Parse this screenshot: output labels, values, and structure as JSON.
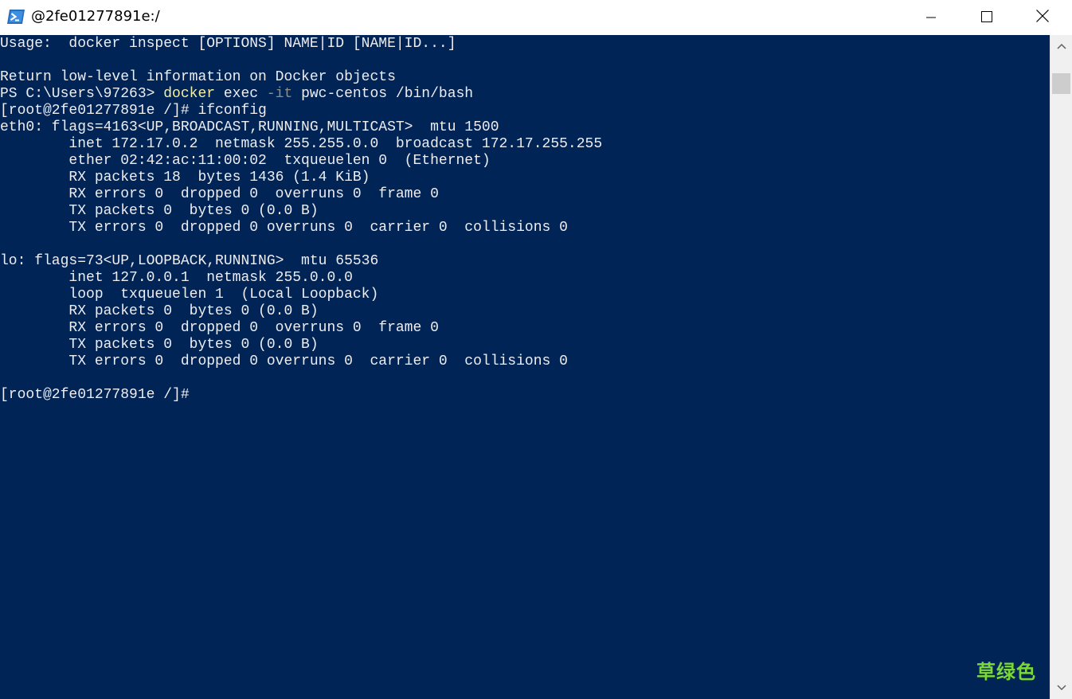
{
  "window": {
    "title": "@2fe01277891e:/",
    "app_icon": "powershell-icon",
    "controls": {
      "minimize_icon": "minimize-icon",
      "maximize_icon": "maximize-icon",
      "close_icon": "close-icon"
    }
  },
  "console": {
    "background": "#012456",
    "foreground": "#eeedf0",
    "command_color": "#f5f0a5",
    "parameter_color": "#8e8e8e",
    "lines": [
      [
        {
          "t": "Usage:  docker inspect [OPTIONS] NAME|ID [NAME|ID...]",
          "s": "plain"
        }
      ],
      [],
      [
        {
          "t": "Return low-level information on Docker objects",
          "s": "plain"
        }
      ],
      [
        {
          "t": "PS C:\\Users\\97263> ",
          "s": "plain"
        },
        {
          "t": "docker",
          "s": "cmd"
        },
        {
          "t": " exec ",
          "s": "plain"
        },
        {
          "t": "-it",
          "s": "param"
        },
        {
          "t": " pwc-centos /bin/bash",
          "s": "plain"
        }
      ],
      [
        {
          "t": "[root@2fe01277891e /]# ifconfig",
          "s": "plain"
        }
      ],
      [
        {
          "t": "eth0: flags=4163<UP,BROADCAST,RUNNING,MULTICAST>  mtu 1500",
          "s": "plain"
        }
      ],
      [
        {
          "t": "        inet 172.17.0.2  netmask 255.255.0.0  broadcast 172.17.255.255",
          "s": "plain"
        }
      ],
      [
        {
          "t": "        ether 02:42:ac:11:00:02  txqueuelen 0  (Ethernet)",
          "s": "plain"
        }
      ],
      [
        {
          "t": "        RX packets 18  bytes 1436 (1.4 KiB)",
          "s": "plain"
        }
      ],
      [
        {
          "t": "        RX errors 0  dropped 0  overruns 0  frame 0",
          "s": "plain"
        }
      ],
      [
        {
          "t": "        TX packets 0  bytes 0 (0.0 B)",
          "s": "plain"
        }
      ],
      [
        {
          "t": "        TX errors 0  dropped 0 overruns 0  carrier 0  collisions 0",
          "s": "plain"
        }
      ],
      [],
      [
        {
          "t": "lo: flags=73<UP,LOOPBACK,RUNNING>  mtu 65536",
          "s": "plain"
        }
      ],
      [
        {
          "t": "        inet 127.0.0.1  netmask 255.0.0.0",
          "s": "plain"
        }
      ],
      [
        {
          "t": "        loop  txqueuelen 1  (Local Loopback)",
          "s": "plain"
        }
      ],
      [
        {
          "t": "        RX packets 0  bytes 0 (0.0 B)",
          "s": "plain"
        }
      ],
      [
        {
          "t": "        RX errors 0  dropped 0  overruns 0  frame 0",
          "s": "plain"
        }
      ],
      [
        {
          "t": "        TX packets 0  bytes 0 (0.0 B)",
          "s": "plain"
        }
      ],
      [
        {
          "t": "        TX errors 0  dropped 0 overruns 0  carrier 0  collisions 0",
          "s": "plain"
        }
      ],
      [],
      [
        {
          "t": "[root@2fe01277891e /]#",
          "s": "plain"
        }
      ]
    ]
  },
  "scrollbar": {
    "up_icon": "chevron-up-icon",
    "down_icon": "chevron-down-icon"
  },
  "watermark": {
    "text": "草绿色",
    "color": "#7cd838"
  }
}
